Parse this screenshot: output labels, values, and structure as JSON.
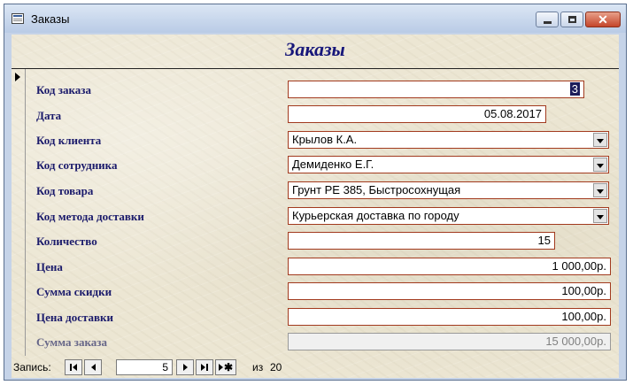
{
  "window": {
    "title": "Заказы"
  },
  "form": {
    "title": "Заказы",
    "fields": [
      {
        "label": "Код заказа",
        "value": "3",
        "kind": "text"
      },
      {
        "label": "Дата",
        "value": "05.08.2017",
        "kind": "date"
      },
      {
        "label": "Код клиента",
        "value": "Крылов К.А.",
        "kind": "combo"
      },
      {
        "label": "Код сотрудника",
        "value": "Демиденко Е.Г.",
        "kind": "combo"
      },
      {
        "label": "Код товара",
        "value": "Грунт PE 385, Быстросохнущая",
        "kind": "combo"
      },
      {
        "label": "Код метода доставки",
        "value": "Курьерская доставка по городу",
        "kind": "combo"
      },
      {
        "label": "Количество",
        "value": "15",
        "kind": "number"
      },
      {
        "label": "Цена",
        "value": "1 000,00р.",
        "kind": "currency"
      },
      {
        "label": "Сумма скидки",
        "value": "100,00р.",
        "kind": "currency"
      },
      {
        "label": "Цена доставки",
        "value": "100,00р.",
        "kind": "currency"
      },
      {
        "label": "Сумма заказа",
        "value": "15 000,00р.",
        "kind": "currency-disabled"
      }
    ]
  },
  "navigation": {
    "label": "Запись:",
    "current": "5",
    "of_label": "из",
    "total": "20"
  }
}
